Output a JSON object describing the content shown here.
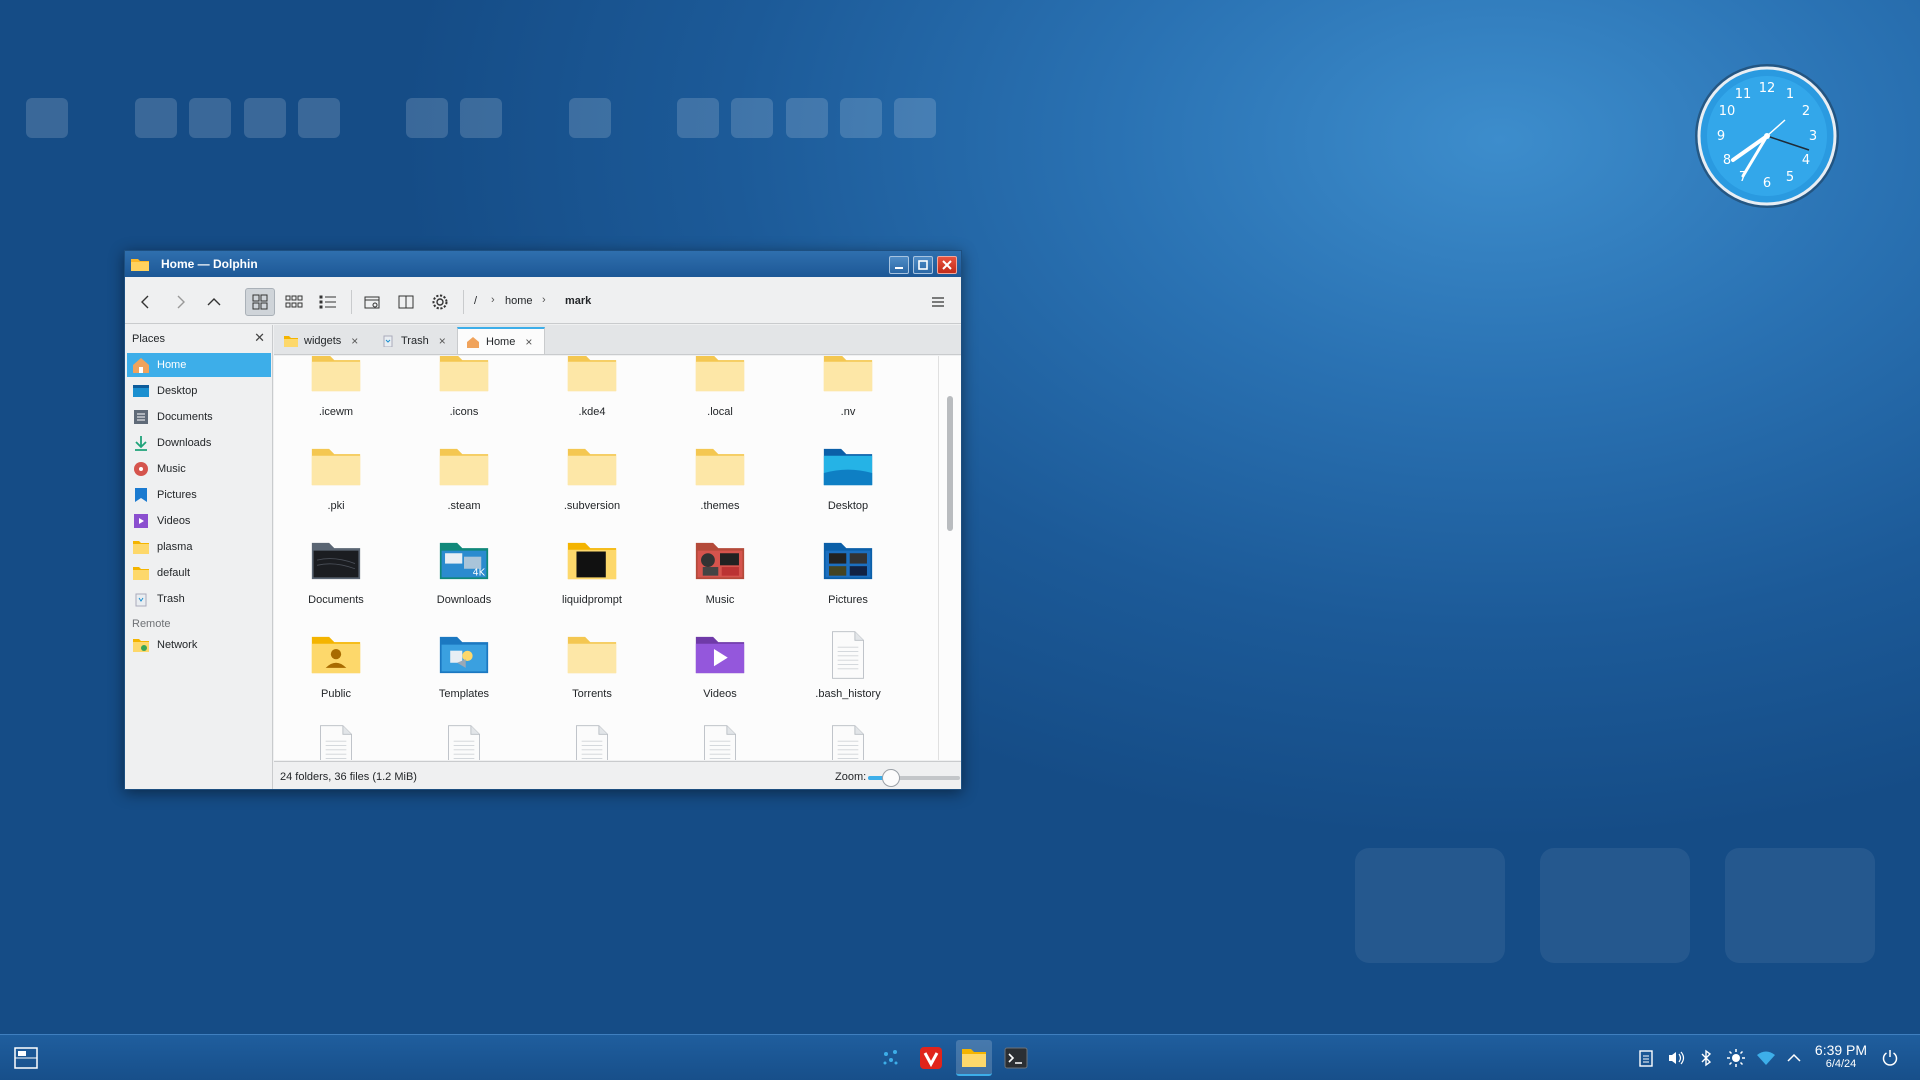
{
  "window": {
    "title": "Home — Dolphin"
  },
  "breadcrumb": {
    "root": "/",
    "parts": [
      "home",
      "mark"
    ]
  },
  "places": {
    "header": "Places",
    "items": [
      {
        "label": "Home",
        "icon": "home-icon",
        "selected": true
      },
      {
        "label": "Desktop",
        "icon": "desktop-icon"
      },
      {
        "label": "Documents",
        "icon": "documents-icon"
      },
      {
        "label": "Downloads",
        "icon": "downloads-icon"
      },
      {
        "label": "Music",
        "icon": "music-icon"
      },
      {
        "label": "Pictures",
        "icon": "pictures-icon"
      },
      {
        "label": "Videos",
        "icon": "videos-icon"
      },
      {
        "label": "plasma",
        "icon": "folder-icon"
      },
      {
        "label": "default",
        "icon": "folder-icon"
      },
      {
        "label": "Trash",
        "icon": "trash-icon"
      }
    ],
    "remote_header": "Remote",
    "remote_items": [
      {
        "label": "Network",
        "icon": "network-icon"
      }
    ]
  },
  "tabs": [
    {
      "label": "widgets",
      "icon": "folder-icon"
    },
    {
      "label": "Trash",
      "icon": "trash-icon"
    },
    {
      "label": "Home",
      "icon": "home-icon",
      "active": true
    }
  ],
  "files": [
    {
      "name": ".icewm",
      "type": "folder"
    },
    {
      "name": ".icons",
      "type": "folder"
    },
    {
      "name": ".kde4",
      "type": "folder"
    },
    {
      "name": ".local",
      "type": "folder"
    },
    {
      "name": ".nv",
      "type": "folder"
    },
    {
      "name": ".pki",
      "type": "folder"
    },
    {
      "name": ".steam",
      "type": "folder"
    },
    {
      "name": ".subversion",
      "type": "folder"
    },
    {
      "name": ".themes",
      "type": "folder"
    },
    {
      "name": "Desktop",
      "type": "folder-desktop"
    },
    {
      "name": "Documents",
      "type": "folder-documents"
    },
    {
      "name": "Downloads",
      "type": "folder-downloads"
    },
    {
      "name": "liquidprompt",
      "type": "folder-terminal"
    },
    {
      "name": "Music",
      "type": "folder-music"
    },
    {
      "name": "Pictures",
      "type": "folder-pictures"
    },
    {
      "name": "Public",
      "type": "folder-public"
    },
    {
      "name": "Templates",
      "type": "folder-templates"
    },
    {
      "name": "Torrents",
      "type": "folder"
    },
    {
      "name": "Videos",
      "type": "folder-videos"
    },
    {
      "name": ".bash_history",
      "type": "text-file"
    },
    {
      "name": "",
      "type": "text-file"
    },
    {
      "name": "",
      "type": "text-file"
    },
    {
      "name": "",
      "type": "text-file"
    },
    {
      "name": "",
      "type": "text-file"
    },
    {
      "name": "",
      "type": "text-file"
    }
  ],
  "status": {
    "summary": "24 folders, 36 files (1.2 MiB)",
    "zoom_label": "Zoom:",
    "zoom_fraction": 0.25
  },
  "taskbar": {
    "time": "6:39 PM",
    "date": "6/4/24"
  },
  "colors": {
    "accent": "#3daee9",
    "folder": "#fdd86b"
  }
}
